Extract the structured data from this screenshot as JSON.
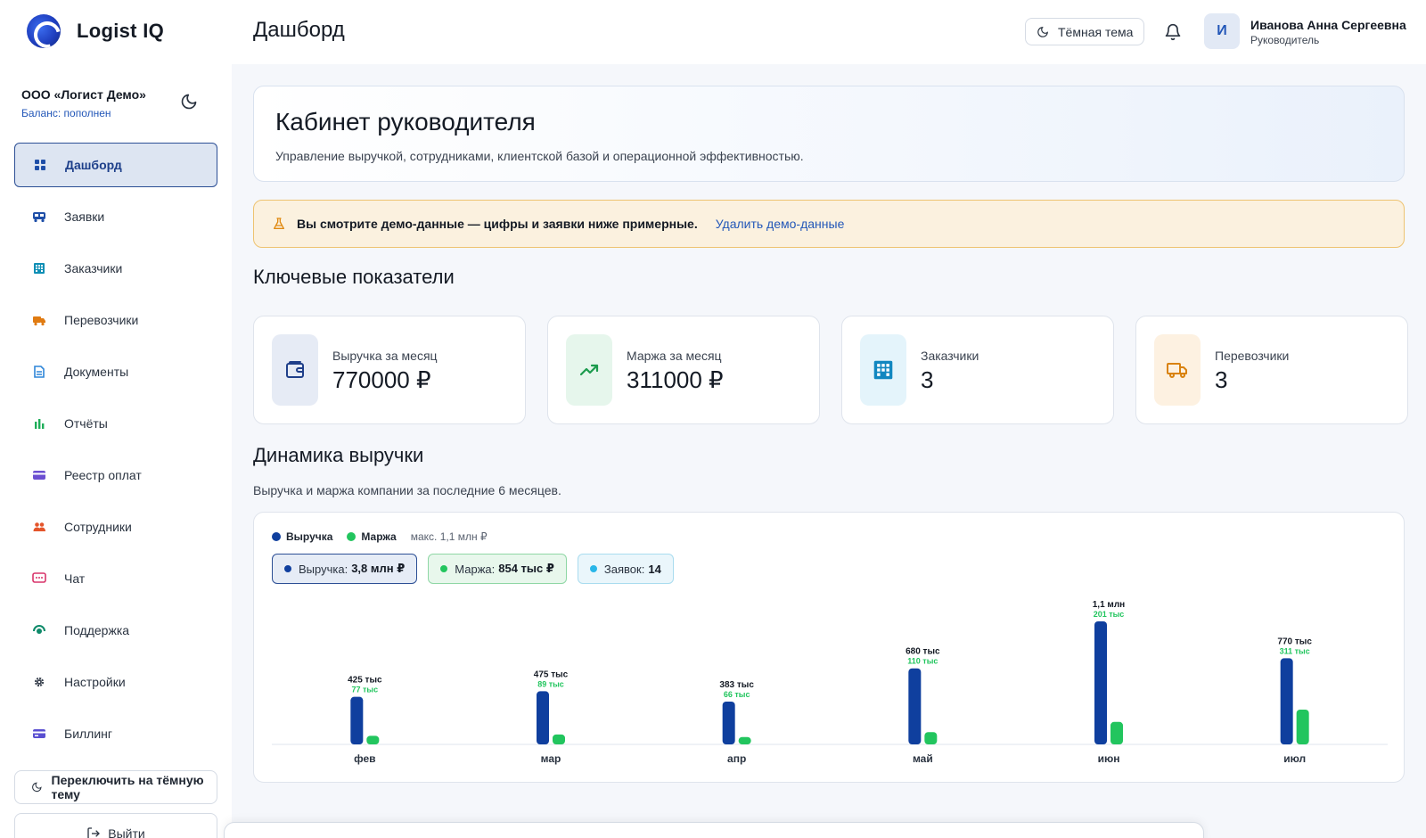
{
  "app": {
    "name": "Logist IQ"
  },
  "org": {
    "name": "ООО «Логист Демо»",
    "balance": "Баланс: пополнен"
  },
  "nav": [
    {
      "label": "Дашборд",
      "icon": "grid-icon",
      "active": true,
      "color": "#1f4fa8"
    },
    {
      "label": "Заявки",
      "icon": "bus-icon",
      "color": "#1f4fa8"
    },
    {
      "label": "Заказчики",
      "icon": "building-icon",
      "color": "#0f8fb5"
    },
    {
      "label": "Перевозчики",
      "icon": "truck-icon",
      "color": "#e07b12"
    },
    {
      "label": "Документы",
      "icon": "document-icon",
      "color": "#2f86d8"
    },
    {
      "label": "Отчёты",
      "icon": "bar-chart-icon",
      "color": "#1fae59"
    },
    {
      "label": "Реестр оплат",
      "icon": "card-icon",
      "color": "#6b4fd1"
    },
    {
      "label": "Сотрудники",
      "icon": "users-icon",
      "color": "#e4552b"
    },
    {
      "label": "Чат",
      "icon": "chat-icon",
      "color": "#d8356b"
    },
    {
      "label": "Поддержка",
      "icon": "support-icon",
      "color": "#0f8a6a"
    },
    {
      "label": "Настройки",
      "icon": "gear-icon",
      "color": "#3b4350"
    },
    {
      "label": "Биллинг",
      "icon": "billing-icon",
      "color": "#5a4fd1"
    }
  ],
  "sidebar": {
    "theme_button": "Переключить на тёмную тему",
    "logout": "Выйти"
  },
  "header": {
    "title": "Дашборд",
    "dark_toggle": "Тёмная тема",
    "avatar_initial": "И",
    "user_name": "Иванова Анна Сергеевна",
    "user_role": "Руководитель"
  },
  "hero": {
    "title": "Кабинет руководителя",
    "subtitle": "Управление выручкой, сотрудниками, клиентской базой и операционной эффективностью."
  },
  "demo": {
    "text": "Вы смотрите демо-данные — цифры и заявки ниже примерные.",
    "link": "Удалить демо-данные"
  },
  "kpi_title": "Ключевые показатели",
  "kpis": [
    {
      "label": "Выручка за месяц",
      "value": "770000 ₽",
      "icon": "wallet-icon",
      "bg": "#e6ebf5",
      "color": "#1f3f8a"
    },
    {
      "label": "Маржа за месяц",
      "value": "311000 ₽",
      "icon": "trend-up-icon",
      "bg": "#e6f6ec",
      "color": "#1c9b4d"
    },
    {
      "label": "Заказчики",
      "value": "3",
      "icon": "building-icon",
      "bg": "#e4f4fb",
      "color": "#1187c0"
    },
    {
      "label": "Перевозчики",
      "value": "3",
      "icon": "truck-icon",
      "bg": "#fdf1e1",
      "color": "#d9820e"
    }
  ],
  "chart_section": {
    "title": "Динамика выручки",
    "subtitle": "Выручка и маржа компании за последние 6 месяцев."
  },
  "chart_legend": {
    "revenue": "Выручка",
    "margin": "Маржа",
    "max": "макс. 1,1 млн ₽"
  },
  "pills": {
    "revenue_label": "Выручка:",
    "revenue_value": "3,8 млн ₽",
    "margin_label": "Маржа:",
    "margin_value": "854 тыс ₽",
    "orders_label": "Заявок:",
    "orders_value": "14"
  },
  "colors": {
    "revenue": "#0f3f9e",
    "margin": "#22c55e",
    "orders": "#29b6e8"
  },
  "chart_data": {
    "type": "bar",
    "categories": [
      "фев",
      "мар",
      "апр",
      "май",
      "июн",
      "июл"
    ],
    "series": [
      {
        "name": "Выручка",
        "values": [
          425000,
          475000,
          383000,
          680000,
          1100000,
          770000
        ],
        "labels": [
          "425 тыс",
          "475 тыс",
          "383 тыс",
          "680 тыс",
          "1,1 млн",
          "770 тыс"
        ]
      },
      {
        "name": "Маржа",
        "values": [
          77000,
          89000,
          66000,
          110000,
          201000,
          311000
        ],
        "labels": [
          "77 тыс",
          "89 тыс",
          "66 тыс",
          "110 тыс",
          "201 тыс",
          "311 тыс"
        ]
      }
    ],
    "ylim": [
      0,
      1100000
    ],
    "grid": false,
    "legend": "top-left"
  }
}
